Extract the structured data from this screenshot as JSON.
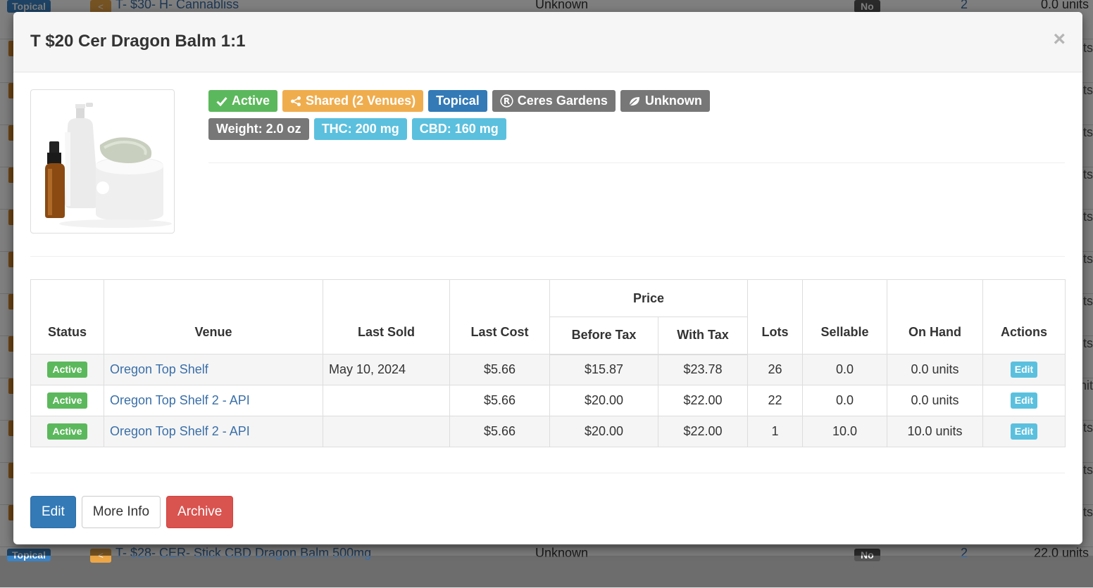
{
  "background": {
    "top_row": {
      "category": "Topical",
      "product": "T- $30- H- Cannabliss",
      "strain": "Unknown",
      "flag": "No",
      "count": "2",
      "units": "0.0 units"
    },
    "bottom_row": {
      "category": "Topical",
      "product": "T- $28- CER- Stick CBD Dragon Balm 500mg",
      "strain": "Unknown",
      "flag": "No",
      "count": "2",
      "units": "22.0 units"
    },
    "edge_fragments": [
      "ts",
      "ts",
      "ts",
      "ts",
      "ts",
      "ts",
      "ts",
      "ts",
      "nit",
      "ts",
      "ts",
      "ts"
    ]
  },
  "modal": {
    "title": "T $20 Cer Dragon Balm 1:1",
    "close_label": "×",
    "labels": {
      "status": "Active",
      "shared": "Shared (2 Venues)",
      "category": "Topical",
      "brand": "Ceres Gardens",
      "strain": "Unknown",
      "weight": "Weight: 2.0 oz",
      "thc": "THC: 200 mg",
      "cbd": "CBD: 160 mg"
    },
    "table": {
      "headers": {
        "status": "Status",
        "venue": "Venue",
        "last_sold": "Last Sold",
        "last_cost": "Last Cost",
        "price": "Price",
        "before_tax": "Before Tax",
        "with_tax": "With Tax",
        "lots": "Lots",
        "sellable": "Sellable",
        "on_hand": "On Hand",
        "actions": "Actions"
      },
      "rows": [
        {
          "status": "Active",
          "venue": "Oregon Top Shelf",
          "last_sold": "May 10, 2024",
          "last_cost": "$5.66",
          "before_tax": "$15.87",
          "with_tax": "$23.78",
          "lots": "26",
          "sellable": "0.0",
          "on_hand": "0.0 units",
          "action": "Edit"
        },
        {
          "status": "Active",
          "venue": "Oregon Top Shelf 2 - API",
          "last_sold": "",
          "last_cost": "$5.66",
          "before_tax": "$20.00",
          "with_tax": "$22.00",
          "lots": "22",
          "sellable": "0.0",
          "on_hand": "0.0 units",
          "action": "Edit"
        },
        {
          "status": "Active",
          "venue": "Oregon Top Shelf 2 - API",
          "last_sold": "",
          "last_cost": "$5.66",
          "before_tax": "$20.00",
          "with_tax": "$22.00",
          "lots": "1",
          "sellable": "10.0",
          "on_hand": "10.0 units",
          "action": "Edit"
        }
      ]
    },
    "footer": {
      "edit": "Edit",
      "more_info": "More Info",
      "archive": "Archive"
    }
  }
}
